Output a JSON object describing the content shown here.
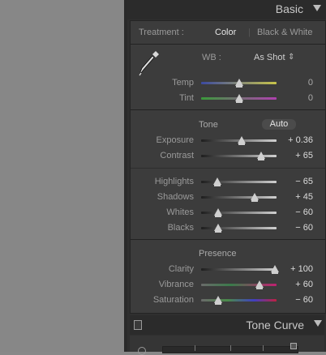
{
  "header": {
    "title": "Basic"
  },
  "treatment": {
    "label": "Treatment :",
    "color": "Color",
    "bw": "Black & White"
  },
  "wb": {
    "label": "WB :",
    "value": "As Shot",
    "arrows": "⇕"
  },
  "tone": {
    "label": "Tone",
    "auto": "Auto"
  },
  "presence": {
    "label": "Presence"
  },
  "sliders": {
    "temp": {
      "label": "Temp",
      "value": "0",
      "pos": 0.5
    },
    "tint": {
      "label": "Tint",
      "value": "0",
      "pos": 0.5
    },
    "exposure": {
      "label": "Exposure",
      "value": "+ 0.36",
      "pos": 0.54
    },
    "contrast": {
      "label": "Contrast",
      "value": "+ 65",
      "pos": 0.79
    },
    "highlights": {
      "label": "Highlights",
      "value": "− 65",
      "pos": 0.21
    },
    "shadows": {
      "label": "Shadows",
      "value": "+ 45",
      "pos": 0.71
    },
    "whites": {
      "label": "Whites",
      "value": "− 60",
      "pos": 0.22
    },
    "blacks": {
      "label": "Blacks",
      "value": "− 60",
      "pos": 0.22
    },
    "clarity": {
      "label": "Clarity",
      "value": "+ 100",
      "pos": 0.98
    },
    "vibrance": {
      "label": "Vibrance",
      "value": "+ 60",
      "pos": 0.77
    },
    "saturation": {
      "label": "Saturation",
      "value": "− 60",
      "pos": 0.22
    }
  },
  "tone_curve": {
    "title": "Tone Curve"
  },
  "colors": {
    "panel": "#3c3c3c",
    "header": "#2b2b2b",
    "highlight_text": "#e6e6e6"
  }
}
